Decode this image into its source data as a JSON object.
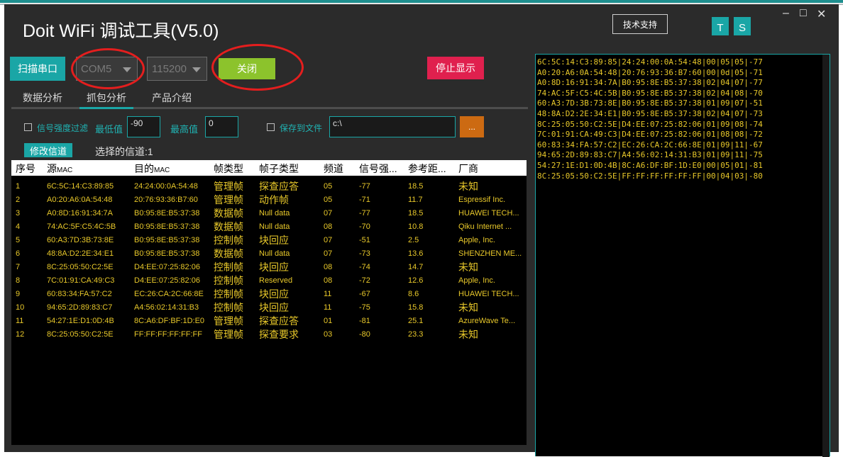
{
  "app": {
    "title": "Doit WiFi 调试工具(V5.0)",
    "support_label": "技术支持",
    "t_label": "T",
    "s_label": "S",
    "minimize": "–",
    "maximize": "□",
    "close": "✕"
  },
  "toolbar": {
    "scan_label": "扫描串口",
    "port_value": "COM5",
    "baud_value": "115200",
    "close_label": "关闭",
    "stop_label": "停止显示"
  },
  "tabs": [
    {
      "label": "数据分析"
    },
    {
      "label": "抓包分析"
    },
    {
      "label": "产品介绍"
    }
  ],
  "filter": {
    "rssi_filter_label": "信号强度过滤",
    "min_label": "最低值",
    "min_value": "-90",
    "max_label": "最高值",
    "max_value": "0",
    "save_label": "保存到文件",
    "path_value": "c:\\",
    "browse_label": "..."
  },
  "channel": {
    "button_label": "修改信道",
    "selected_text": "选择的信道:1"
  },
  "table": {
    "headers": [
      "序号",
      "源",
      "MAC",
      "目的",
      "MAC",
      "帧类型",
      "帧子类型",
      "频道",
      "信号强...",
      "参考距...",
      "厂商"
    ],
    "rows": [
      {
        "no": "1",
        "src": "6C:5C:14:C3:89:85",
        "dst": "24:24:00:0A:54:48",
        "type": "管理帧",
        "subtype": "探查应答",
        "ch": "05",
        "rssi": "-77",
        "dist": "18.5",
        "vendor": "未知"
      },
      {
        "no": "2",
        "src": "A0:20:A6:0A:54:48",
        "dst": "20:76:93:36:B7:60",
        "type": "管理帧",
        "subtype": "动作帧",
        "ch": "05",
        "rssi": "-71",
        "dist": "11.7",
        "vendor": "Espressif Inc."
      },
      {
        "no": "3",
        "src": "A0:8D:16:91:34:7A",
        "dst": "B0:95:8E:B5:37:38",
        "type": "数据帧",
        "subtype": "Null data",
        "ch": "07",
        "rssi": "-77",
        "dist": "18.5",
        "vendor": "HUAWEI TECH..."
      },
      {
        "no": "4",
        "src": "74:AC:5F:C5:4C:5B",
        "dst": "B0:95:8E:B5:37:38",
        "type": "数据帧",
        "subtype": "Null data",
        "ch": "08",
        "rssi": "-70",
        "dist": "10.8",
        "vendor": "Qiku Internet ..."
      },
      {
        "no": "5",
        "src": "60:A3:7D:3B:73:8E",
        "dst": "B0:95:8E:B5:37:38",
        "type": "控制帧",
        "subtype": "块回应",
        "ch": "07",
        "rssi": "-51",
        "dist": "2.5",
        "vendor": "Apple, Inc."
      },
      {
        "no": "6",
        "src": "48:8A:D2:2E:34:E1",
        "dst": "B0:95:8E:B5:37:38",
        "type": "数据帧",
        "subtype": "Null data",
        "ch": "07",
        "rssi": "-73",
        "dist": "13.6",
        "vendor": "SHENZHEN ME..."
      },
      {
        "no": "7",
        "src": "8C:25:05:50:C2:5E",
        "dst": "D4:EE:07:25:82:06",
        "type": "控制帧",
        "subtype": "块回应",
        "ch": "08",
        "rssi": "-74",
        "dist": "14.7",
        "vendor": "未知"
      },
      {
        "no": "8",
        "src": "7C:01:91:CA:49:C3",
        "dst": "D4:EE:07:25:82:06",
        "type": "控制帧",
        "subtype": "Reserved",
        "ch": "08",
        "rssi": "-72",
        "dist": "12.6",
        "vendor": "Apple, Inc."
      },
      {
        "no": "9",
        "src": "60:83:34:FA:57:C2",
        "dst": "EC:26:CA:2C:66:8E",
        "type": "控制帧",
        "subtype": "块回应",
        "ch": "11",
        "rssi": "-67",
        "dist": "8.6",
        "vendor": "HUAWEI TECH..."
      },
      {
        "no": "10",
        "src": "94:65:2D:89:83:C7",
        "dst": "A4:56:02:14:31:B3",
        "type": "控制帧",
        "subtype": "块回应",
        "ch": "11",
        "rssi": "-75",
        "dist": "15.8",
        "vendor": "未知"
      },
      {
        "no": "11",
        "src": "54:27:1E:D1:0D:4B",
        "dst": "8C:A6:DF:BF:1D:E0",
        "type": "管理帧",
        "subtype": "探查应答",
        "ch": "01",
        "rssi": "-81",
        "dist": "25.1",
        "vendor": "AzureWave Te..."
      },
      {
        "no": "12",
        "src": "8C:25:05:50:C2:5E",
        "dst": "FF:FF:FF:FF:FF:FF",
        "type": "管理帧",
        "subtype": "探查要求",
        "ch": "03",
        "rssi": "-80",
        "dist": "23.3",
        "vendor": "未知"
      }
    ]
  },
  "hex_lines": [
    "6C:5C:14:C3:89:85|24:24:00:0A:54:48|00|05|05|-77",
    "A0:20:A6:0A:54:48|20:76:93:36:B7:60|00|0d|05|-71",
    "A0:8D:16:91:34:7A|B0:95:8E:B5:37:38|02|04|07|-77",
    "74:AC:5F:C5:4C:5B|B0:95:8E:B5:37:38|02|04|08|-70",
    "60:A3:7D:3B:73:8E|B0:95:8E:B5:37:38|01|09|07|-51",
    "48:8A:D2:2E:34:E1|B0:95:8E:B5:37:38|02|04|07|-73",
    "8C:25:05:50:C2:5E|D4:EE:07:25:82:06|01|09|08|-74",
    "7C:01:91:CA:49:C3|D4:EE:07:25:82:06|01|08|08|-72",
    "60:83:34:FA:57:C2|EC:26:CA:2C:66:8E|01|09|11|-67",
    "94:65:2D:89:83:C7|A4:56:02:14:31:B3|01|09|11|-75",
    "54:27:1E:D1:0D:4B|8C:A6:DF:BF:1D:E0|00|05|01|-81",
    "8C:25:05:50:C2:5E|FF:FF:FF:FF:FF:FF|00|04|03|-80"
  ]
}
